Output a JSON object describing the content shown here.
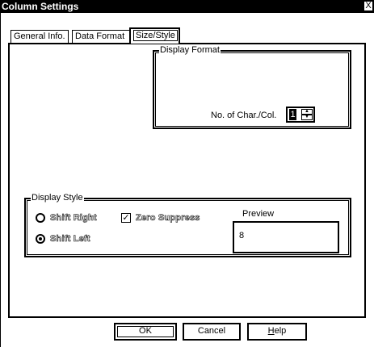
{
  "window": {
    "title": "Column Settings",
    "close_glyph": "X"
  },
  "tabs": [
    {
      "label": "General Info."
    },
    {
      "label": "Data Format"
    },
    {
      "label": "Size/Style"
    }
  ],
  "display_format": {
    "label": "Display Format",
    "char_col_label": "No. of Char./Col.",
    "char_col_value": "1"
  },
  "display_style": {
    "label": "Display Style",
    "shift_right": "Shift Right",
    "shift_left": "Shift Left",
    "zero_suppress": "Zero Suppress",
    "preview_label": "Preview",
    "preview_value": "8",
    "selected": "Shift Left",
    "zero_suppress_checked": true
  },
  "buttons": {
    "ok": "OK",
    "cancel": "Cancel",
    "help_first": "H",
    "help_rest": "elp"
  }
}
